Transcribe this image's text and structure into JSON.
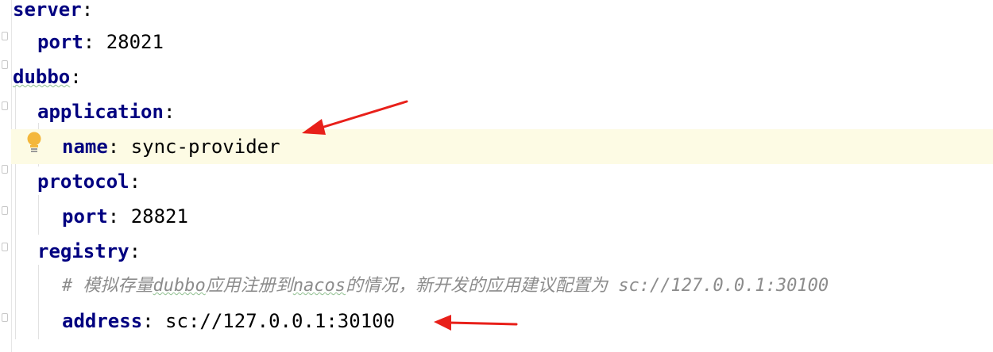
{
  "editor": {
    "lines": [
      {
        "key": "server",
        "sep": ":",
        "value": ""
      },
      {
        "key": "port",
        "sep": ":",
        "value": " 28021"
      },
      {
        "key": "dubbo",
        "sep": ":",
        "value": ""
      },
      {
        "key": "application",
        "sep": ":",
        "value": ""
      },
      {
        "key": "name",
        "sep": ":",
        "value": " sync-provider"
      },
      {
        "key": "protocol",
        "sep": ":",
        "value": ""
      },
      {
        "key": "port",
        "sep": ":",
        "value": " 28821"
      },
      {
        "key": "registry",
        "sep": ":",
        "value": ""
      },
      {
        "comment": {
          "prefix": "# 模拟存量",
          "w1": "dubbo",
          "mid": "应用注册到",
          "w2": "nacos",
          "rest": "的情况，新开发的应用建议配置为 sc://127.0.0.1:30100"
        }
      },
      {
        "key": "address",
        "sep": ":",
        "value": " sc://127.0.0.1:30100"
      }
    ]
  },
  "highlighted_line": 5,
  "colors": {
    "key": "#000080",
    "comment": "#8c8c8c",
    "highlight_bg": "#fdfbe4",
    "arrow": "#e8201a",
    "bulb": "#f4b73b"
  },
  "icons": [
    "intention-bulb-icon",
    "red-arrow-annotation"
  ]
}
